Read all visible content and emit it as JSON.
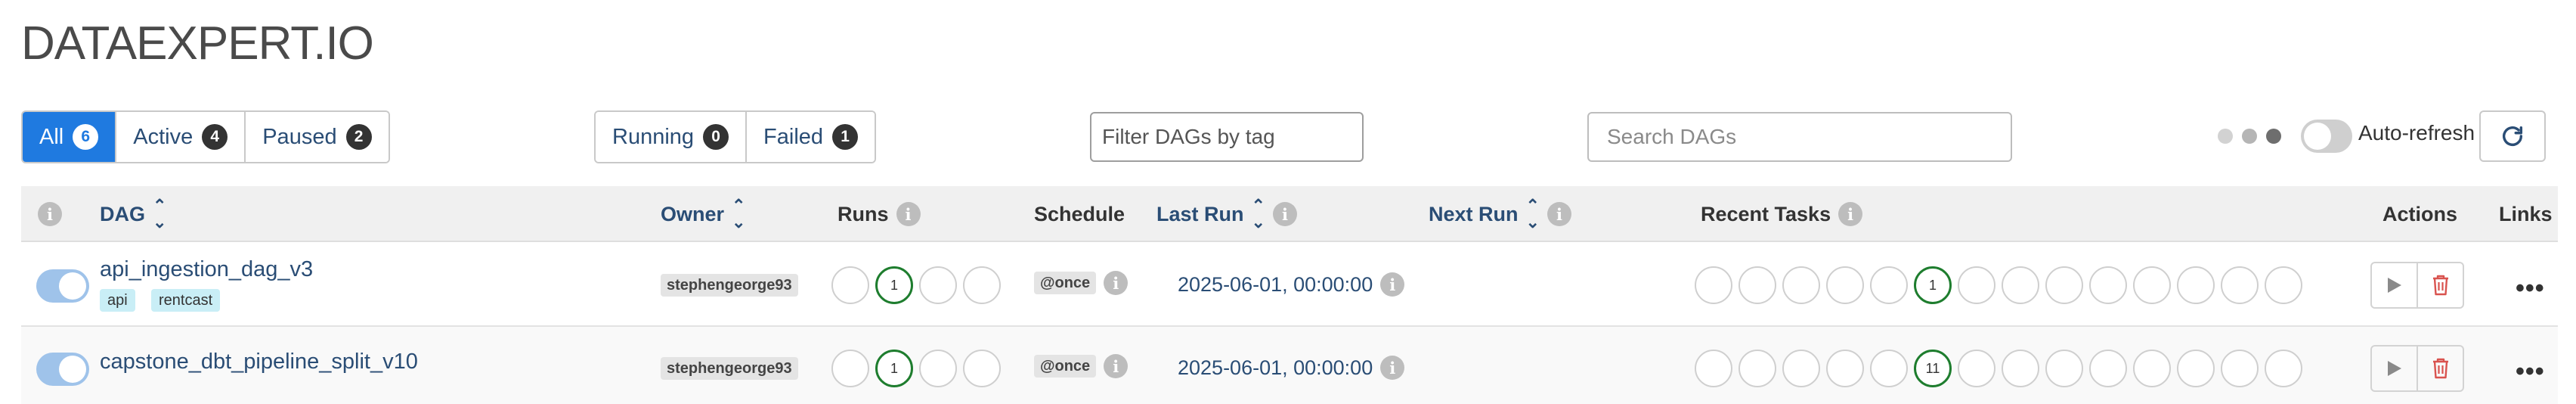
{
  "brand": "DATAEXPERT.IO",
  "status_tabs": [
    {
      "label": "All",
      "count": "6"
    },
    {
      "label": "Active",
      "count": "4"
    },
    {
      "label": "Paused",
      "count": "2"
    }
  ],
  "run_tabs": [
    {
      "label": "Running",
      "count": "0"
    },
    {
      "label": "Failed",
      "count": "1"
    }
  ],
  "filters": {
    "tag_placeholder": "Filter DAGs by tag",
    "search_placeholder": "Search DAGs"
  },
  "auto_refresh_label": "Auto-refresh",
  "columns": {
    "dag": "DAG",
    "owner": "Owner",
    "runs": "Runs",
    "schedule": "Schedule",
    "last_run": "Last Run",
    "next_run": "Next Run",
    "recent_tasks": "Recent Tasks",
    "actions": "Actions",
    "links": "Links"
  },
  "rows": [
    {
      "name": "api_ingestion_dag_v3",
      "tags": [
        "api",
        "rentcast"
      ],
      "owner": "stephengeorge93",
      "runs_success": "1",
      "schedule": "@once",
      "last_run": "2025-06-01, 00:00:00",
      "tasks_success": "1"
    },
    {
      "name": "capstone_dbt_pipeline_split_v10",
      "tags": [],
      "owner": "stephengeorge93",
      "runs_success": "1",
      "schedule": "@once",
      "last_run": "2025-06-01, 00:00:00",
      "tasks_success": "11"
    }
  ],
  "colors": {
    "primary": "#1f7ae0",
    "link": "#2a4d75",
    "success": "#1e7d2e",
    "danger": "#d9534f",
    "tag_bg": "#c9eef6"
  },
  "icons": {
    "info": "info-icon",
    "sort": "sort-icon",
    "refresh": "refresh-icon",
    "trigger": "play-icon",
    "delete": "trash-icon",
    "more": "more-icon"
  }
}
